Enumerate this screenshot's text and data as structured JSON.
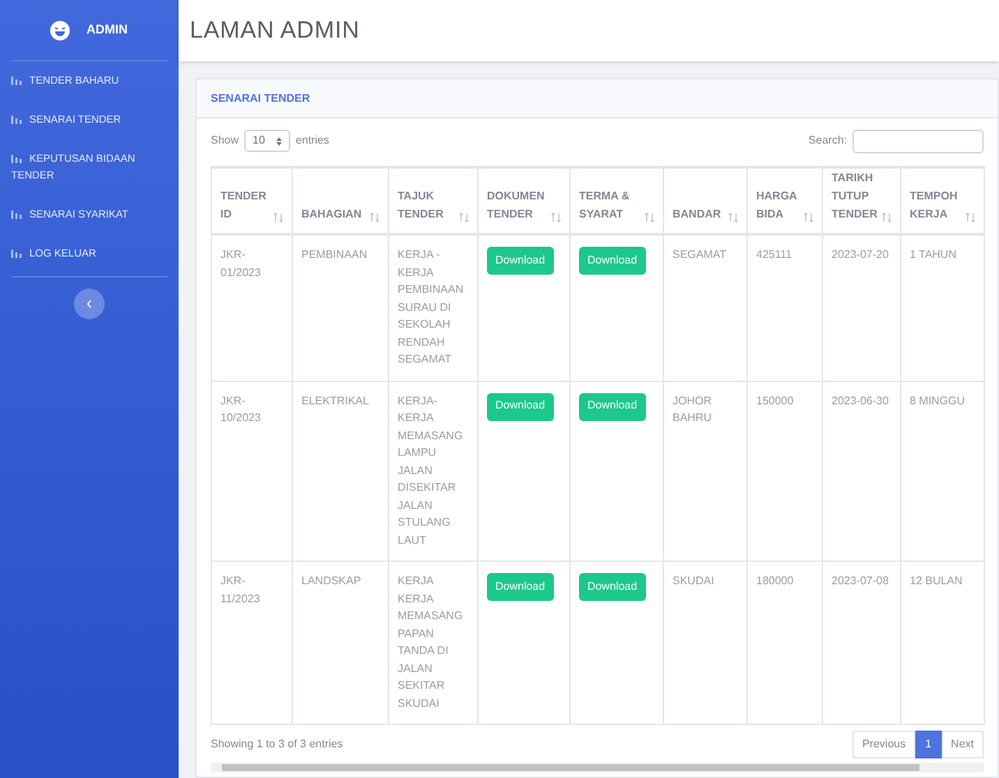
{
  "sidebar": {
    "brand": "ADMIN",
    "items": [
      {
        "label": "TENDER BAHARU"
      },
      {
        "label": "SENARAI TENDER"
      },
      {
        "label": "KEPUTUSAN BIDAAN TENDER"
      },
      {
        "label": "SENARAI SYARIKAT"
      },
      {
        "label": "LOG KELUAR"
      }
    ]
  },
  "page_title": "LAMAN ADMIN",
  "card": {
    "title": "SENARAI TENDER",
    "length": {
      "before": "Show",
      "value": "10",
      "after": "entries"
    },
    "search": {
      "label": "Search:"
    },
    "table": {
      "columns": [
        "TENDER ID",
        "BAHAGIAN",
        "TAJUK TENDER",
        "DOKUMEN TENDER",
        "TERMA & SYARAT",
        "BANDAR",
        "HARGA BIDA",
        "TARIKH TUTUP TENDER",
        "TEMPOH KERJA"
      ],
      "rows": [
        {
          "id": "JKR-01/2023",
          "bahagian": "PEMBINAAN",
          "tajuk": "KERJA - KERJA PEMBINAAN SURAU DI SEKOLAH RENDAH SEGAMAT",
          "dokumen": "Download",
          "terma": "Download",
          "bandar": "SEGAMAT",
          "harga": "425111",
          "tarikh": "2023-07-20",
          "tempoh": "1 TAHUN"
        },
        {
          "id": "JKR-10/2023",
          "bahagian": "ELEKTRIKAL",
          "tajuk": "KERJA-KERJA MEMASANG LAMPU JALAN DISEKITAR JALAN STULANG LAUT",
          "dokumen": "Download",
          "terma": "Download",
          "bandar": "JOHOR BAHRU",
          "harga": "150000",
          "tarikh": "2023-06-30",
          "tempoh": "8 MINGGU"
        },
        {
          "id": "JKR-11/2023",
          "bahagian": "LANDSKAP",
          "tajuk": "KERJA KERJA MEMASANG PAPAN TANDA DI JALAN SEKITAR SKUDAI",
          "dokumen": "Download",
          "terma": "Download",
          "bandar": "SKUDAI",
          "harga": "180000",
          "tarikh": "2023-07-08",
          "tempoh": "12 BULAN"
        }
      ]
    },
    "info": "Showing 1 to 3 of 3 entries",
    "pagination": [
      {
        "label": "Previous",
        "selected": false
      },
      {
        "label": "1",
        "selected": true
      },
      {
        "label": "Next",
        "selected": false
      }
    ]
  }
}
